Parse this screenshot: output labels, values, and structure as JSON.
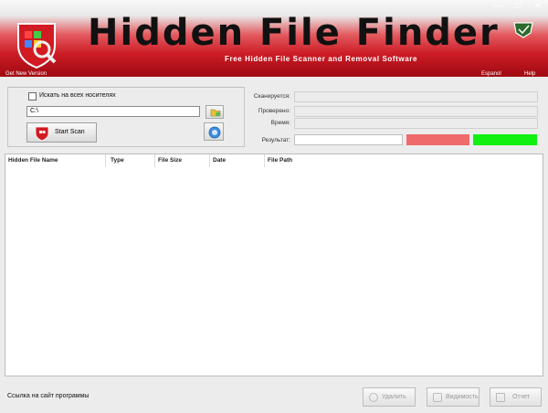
{
  "header": {
    "title": "Hidden File Finder",
    "subtitle": "Free Hidden File Scanner and Removal Software",
    "get_new_version": "Get New Version",
    "lang_primary": "Espanol",
    "lang_secondary": "Help"
  },
  "window_controls": [
    "—",
    "□",
    "✕"
  ],
  "scan_panel": {
    "search_all_drives_label": "Искать на всех носителях",
    "path_value": "C:\\",
    "start_scan_label": "Start Scan"
  },
  "status_panel": {
    "scanning_label": "Сканируется:",
    "checked_label": "Проверено:",
    "time_label": "Время:",
    "result_label": "Результат:"
  },
  "colors": {
    "result_red": "#ef6a6a",
    "result_green": "#11f011",
    "banner_red": "#cc1c26"
  },
  "table": {
    "columns": [
      "Hidden File Name",
      "Type",
      "File Size",
      "Date",
      "File Path"
    ],
    "rows": []
  },
  "footer": {
    "site_link": "Ссылка на сайт программы",
    "delete_label": "Удалить",
    "visibility_label": "Видимость",
    "report_label": "Отчет"
  }
}
